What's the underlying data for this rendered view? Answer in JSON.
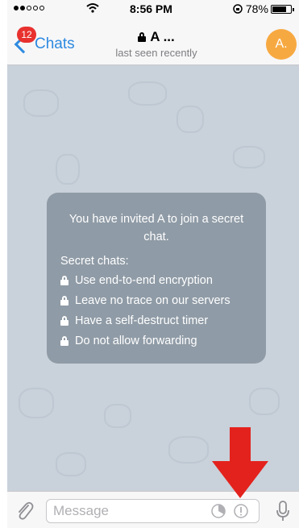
{
  "status_bar": {
    "time": "8:56 PM",
    "battery": "78%",
    "battery_level": 0.78
  },
  "nav": {
    "back_label": "Chats",
    "badge_count": "12",
    "title": "A ...",
    "subtitle": "last seen recently",
    "avatar_initial": "A."
  },
  "message": {
    "title": "You have invited A to join a secret chat.",
    "heading": "Secret chats:",
    "features": [
      "Use end-to-end encryption",
      "Leave no trace on our servers",
      "Have a self-destruct timer",
      "Do not allow forwarding"
    ]
  },
  "input": {
    "placeholder": "Message"
  },
  "colors": {
    "accent": "#2d8ae0",
    "badge": "#e8312e",
    "avatar": "#f7a941",
    "bubble": "#8f9ba6",
    "arrow": "#e3221d"
  },
  "icons": [
    "back-chevron-icon",
    "lock-icon",
    "paperclip-icon",
    "timer-icon",
    "info-icon",
    "microphone-icon",
    "red-arrow-icon"
  ]
}
